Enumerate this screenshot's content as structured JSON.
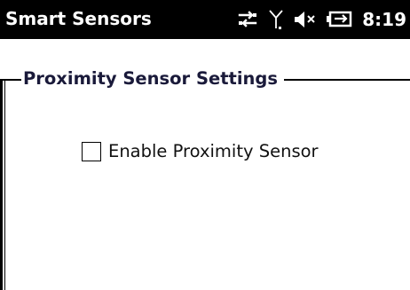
{
  "status_bar": {
    "app_title": "Smart Sensors",
    "time": "8:19",
    "icons": [
      "connectivity-arrows-icon",
      "signal-antenna-icon",
      "speaker-muted-icon",
      "battery-charging-icon"
    ]
  },
  "group": {
    "title": "Proximity Sensor Settings"
  },
  "settings": {
    "enable_proximity_label": "Enable Proximity Sensor",
    "enable_proximity_checked": false
  }
}
